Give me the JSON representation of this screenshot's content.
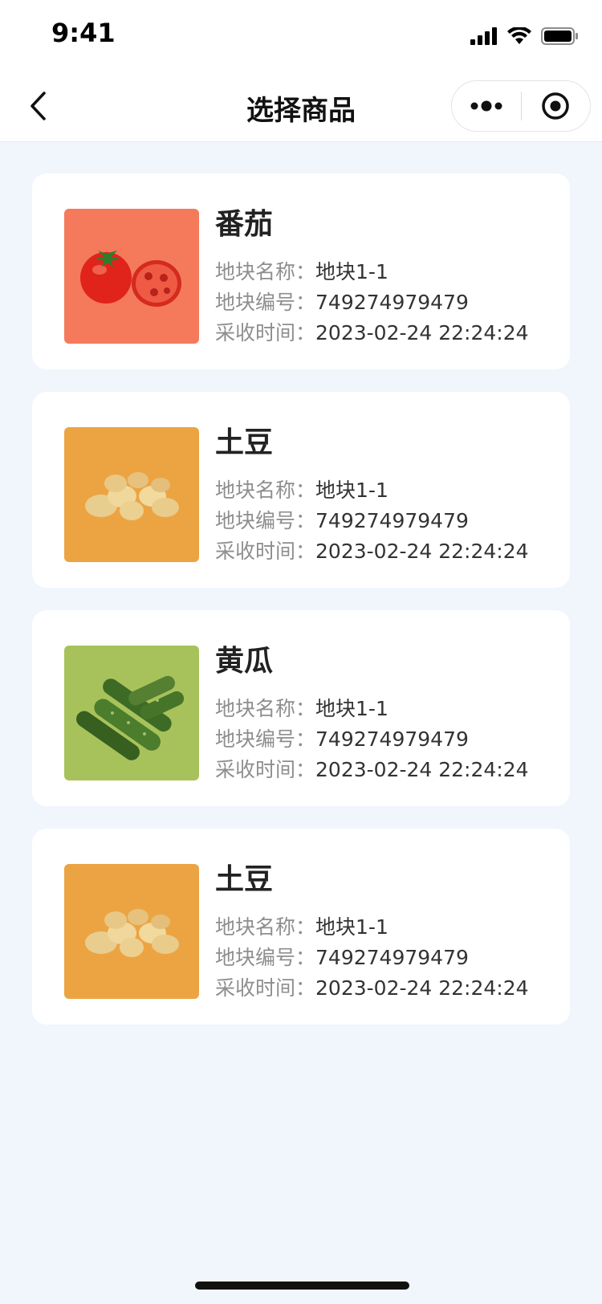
{
  "status": {
    "time": "9:41"
  },
  "nav": {
    "title": "选择商品"
  },
  "items": [
    {
      "name": "番茄",
      "plot_name_label": "地块名称：",
      "plot_name": "地块1-1",
      "plot_no_label": "地块编号：",
      "plot_no": "749274979479",
      "harvest_label": "采收时间：",
      "harvest_time": "2023-02-24 22:24:24",
      "image": "tomato",
      "bg": "#f47a5b"
    },
    {
      "name": "土豆",
      "plot_name_label": "地块名称：",
      "plot_name": "地块1-1",
      "plot_no_label": "地块编号：",
      "plot_no": "749274979479",
      "harvest_label": "采收时间：",
      "harvest_time": "2023-02-24 22:24:24",
      "image": "potato",
      "bg": "#eca443"
    },
    {
      "name": "黄瓜",
      "plot_name_label": "地块名称：",
      "plot_name": "地块1-1",
      "plot_no_label": "地块编号：",
      "plot_no": "749274979479",
      "harvest_label": "采收时间：",
      "harvest_time": "2023-02-24 22:24:24",
      "image": "cucumber",
      "bg": "#a8c25b"
    },
    {
      "name": "土豆",
      "plot_name_label": "地块名称：",
      "plot_name": "地块1-1",
      "plot_no_label": "地块编号：",
      "plot_no": "749274979479",
      "harvest_label": "采收时间：",
      "harvest_time": "2023-02-24 22:24:24",
      "image": "potato",
      "bg": "#eca443"
    }
  ]
}
